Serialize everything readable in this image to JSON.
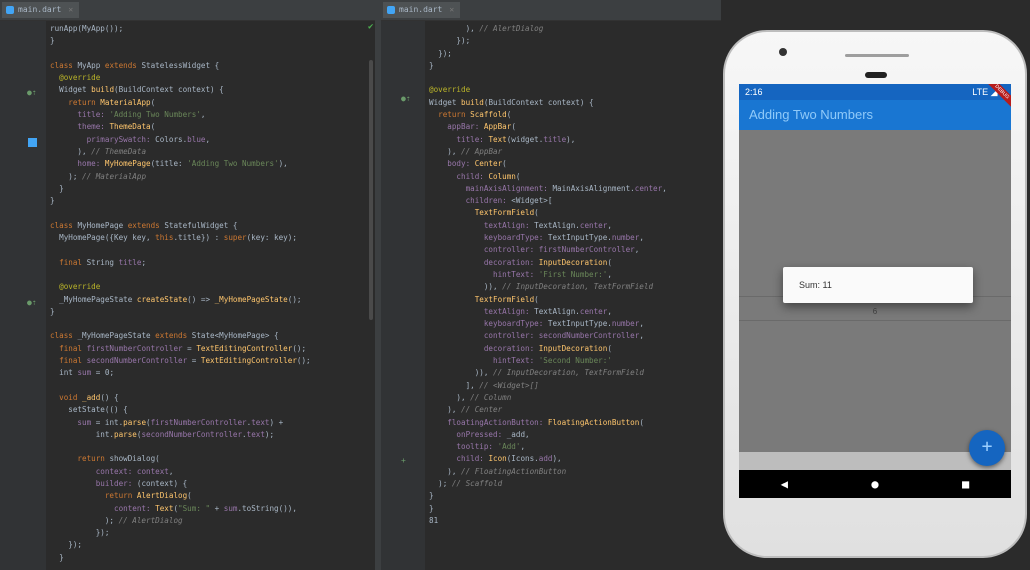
{
  "editor_left": {
    "tab_label": "main.dart",
    "line_numbers": [
      "",
      "",
      "",
      "",
      "",
      "",
      "",
      "",
      "",
      "",
      "",
      "",
      "",
      "",
      "",
      "",
      "",
      "",
      "",
      "",
      "",
      "",
      "",
      "",
      "",
      "",
      "",
      "",
      "",
      "",
      "",
      "",
      "",
      "",
      "",
      "",
      "",
      "",
      "",
      "",
      "",
      "",
      "",
      "",
      ""
    ],
    "lines": [
      [
        [
          "t",
          "runApp(MyApp());"
        ]
      ],
      [
        [
          "t",
          "}"
        ]
      ],
      [],
      [
        [
          "kw",
          "class "
        ],
        [
          "t",
          "MyApp "
        ],
        [
          "kw",
          "extends "
        ],
        [
          "t",
          "StatelessWidget {"
        ]
      ],
      [
        [
          "ann",
          "  @override"
        ]
      ],
      [
        [
          "t",
          "  Widget "
        ],
        [
          "fn",
          "build"
        ],
        [
          "t",
          "(BuildContext context) {"
        ]
      ],
      [
        [
          "kw",
          "    return "
        ],
        [
          "fn",
          "MaterialApp"
        ],
        [
          "t",
          "("
        ]
      ],
      [
        [
          "prop",
          "      title: "
        ],
        [
          "str",
          "'Adding Two Numbers'"
        ],
        [
          "t",
          ","
        ]
      ],
      [
        [
          "prop",
          "      theme: "
        ],
        [
          "fn",
          "ThemeData"
        ],
        [
          "t",
          "("
        ]
      ],
      [
        [
          "prop",
          "        primarySwatch: "
        ],
        [
          "t",
          "Colors."
        ],
        [
          "prop",
          "blue"
        ],
        [
          "t",
          ","
        ]
      ],
      [
        [
          "t",
          "      ), "
        ],
        [
          "cmt",
          "// ThemeData"
        ]
      ],
      [
        [
          "prop",
          "      home: "
        ],
        [
          "fn",
          "MyHomePage"
        ],
        [
          "t",
          "(title: "
        ],
        [
          "str",
          "'Adding Two Numbers'"
        ],
        [
          "t",
          "),"
        ]
      ],
      [
        [
          "t",
          "    ); "
        ],
        [
          "cmt",
          "// MaterialApp"
        ]
      ],
      [
        [
          "t",
          "  }"
        ]
      ],
      [
        [
          "t",
          "}"
        ]
      ],
      [],
      [
        [
          "kw",
          "class "
        ],
        [
          "t",
          "MyHomePage "
        ],
        [
          "kw",
          "extends "
        ],
        [
          "t",
          "StatefulWidget {"
        ]
      ],
      [
        [
          "t",
          "  MyHomePage({Key key, "
        ],
        [
          "kw",
          "this"
        ],
        [
          "t",
          ".title}) : "
        ],
        [
          "kw",
          "super"
        ],
        [
          "t",
          "(key: key);"
        ]
      ],
      [],
      [
        [
          "kw",
          "  final "
        ],
        [
          "t",
          "String "
        ],
        [
          "prop",
          "title"
        ],
        [
          "t",
          ";"
        ]
      ],
      [],
      [
        [
          "ann",
          "  @override"
        ]
      ],
      [
        [
          "t",
          "  _MyHomePageState "
        ],
        [
          "fn",
          "createState"
        ],
        [
          "t",
          "() => "
        ],
        [
          "fn",
          "_MyHomePageState"
        ],
        [
          "t",
          "();"
        ]
      ],
      [
        [
          "t",
          "}"
        ]
      ],
      [],
      [
        [
          "kw",
          "class "
        ],
        [
          "t",
          "_MyHomePageState "
        ],
        [
          "kw",
          "extends "
        ],
        [
          "t",
          "State<MyHomePage> {"
        ]
      ],
      [
        [
          "kw",
          "  final "
        ],
        [
          "prop",
          "firstNumberController"
        ],
        [
          "t",
          " = "
        ],
        [
          "fn",
          "TextEditingController"
        ],
        [
          "t",
          "();"
        ]
      ],
      [
        [
          "kw",
          "  final "
        ],
        [
          "prop",
          "secondNumberController"
        ],
        [
          "t",
          " = "
        ],
        [
          "fn",
          "TextEditingController"
        ],
        [
          "t",
          "();"
        ]
      ],
      [
        [
          "t",
          "  int "
        ],
        [
          "prop",
          "sum"
        ],
        [
          "t",
          " = "
        ],
        [
          "t",
          "0;"
        ]
      ],
      [],
      [
        [
          "kw",
          "  void "
        ],
        [
          "fn",
          "_add"
        ],
        [
          "t",
          "() {"
        ]
      ],
      [
        [
          "t",
          "    setState(() {"
        ]
      ],
      [
        [
          "prop",
          "      sum"
        ],
        [
          "t",
          " = int."
        ],
        [
          "fn",
          "parse"
        ],
        [
          "t",
          "("
        ],
        [
          "prop",
          "firstNumberController"
        ],
        [
          "t",
          "."
        ],
        [
          "prop",
          "text"
        ],
        [
          "t",
          ") +"
        ]
      ],
      [
        [
          "t",
          "          int."
        ],
        [
          "fn",
          "parse"
        ],
        [
          "t",
          "("
        ],
        [
          "prop",
          "secondNumberController"
        ],
        [
          "t",
          "."
        ],
        [
          "prop",
          "text"
        ],
        [
          "t",
          ");"
        ]
      ],
      [],
      [
        [
          "kw",
          "      return "
        ],
        [
          "t",
          "showDialog("
        ]
      ],
      [
        [
          "prop",
          "          context: "
        ],
        [
          "prop",
          "context"
        ],
        [
          "t",
          ","
        ]
      ],
      [
        [
          "prop",
          "          builder: "
        ],
        [
          "t",
          "(context) {"
        ]
      ],
      [
        [
          "kw",
          "            return "
        ],
        [
          "fn",
          "AlertDialog"
        ],
        [
          "t",
          "("
        ]
      ],
      [
        [
          "prop",
          "              content: "
        ],
        [
          "fn",
          "Text"
        ],
        [
          "t",
          "("
        ],
        [
          "str",
          "\"Sum: \""
        ],
        [
          "t",
          " + "
        ],
        [
          "prop",
          "sum"
        ],
        [
          "t",
          ".toString()),"
        ]
      ],
      [
        [
          "t",
          "            ); "
        ],
        [
          "cmt",
          "// AlertDialog"
        ]
      ],
      [
        [
          "t",
          "          });"
        ]
      ],
      [
        [
          "t",
          "    });"
        ]
      ],
      [
        [
          "t",
          "  }"
        ]
      ]
    ]
  },
  "editor_right": {
    "tab_label": "main.dart",
    "lines": [
      [
        [
          "t",
          "        ), "
        ],
        [
          "cmt",
          "// AlertDialog"
        ]
      ],
      [
        [
          "t",
          "      });"
        ]
      ],
      [
        [
          "t",
          "  });"
        ]
      ],
      [
        [
          "t",
          "}"
        ]
      ],
      [],
      [
        [
          "ann",
          "@override"
        ]
      ],
      [
        [
          "t",
          "Widget "
        ],
        [
          "fn",
          "build"
        ],
        [
          "t",
          "(BuildContext context) {"
        ]
      ],
      [
        [
          "kw",
          "  return "
        ],
        [
          "fn",
          "Scaffold"
        ],
        [
          "t",
          "("
        ]
      ],
      [
        [
          "prop",
          "    appBar: "
        ],
        [
          "fn",
          "AppBar"
        ],
        [
          "t",
          "("
        ]
      ],
      [
        [
          "prop",
          "      title: "
        ],
        [
          "fn",
          "Text"
        ],
        [
          "t",
          "(widget."
        ],
        [
          "prop",
          "title"
        ],
        [
          "t",
          "),"
        ]
      ],
      [
        [
          "t",
          "    ), "
        ],
        [
          "cmt",
          "// AppBar"
        ]
      ],
      [
        [
          "prop",
          "    body: "
        ],
        [
          "fn",
          "Center"
        ],
        [
          "t",
          "("
        ]
      ],
      [
        [
          "prop",
          "      child: "
        ],
        [
          "fn",
          "Column"
        ],
        [
          "t",
          "("
        ]
      ],
      [
        [
          "prop",
          "        mainAxisAlignment: "
        ],
        [
          "t",
          "MainAxisAlignment."
        ],
        [
          "prop",
          "center"
        ],
        [
          "t",
          ","
        ]
      ],
      [
        [
          "prop",
          "        children: "
        ],
        [
          "t",
          "<Widget>["
        ]
      ],
      [
        [
          "fn",
          "          TextFormField"
        ],
        [
          "t",
          "("
        ]
      ],
      [
        [
          "prop",
          "            textAlign: "
        ],
        [
          "t",
          "TextAlign."
        ],
        [
          "prop",
          "center"
        ],
        [
          "t",
          ","
        ]
      ],
      [
        [
          "prop",
          "            keyboardType: "
        ],
        [
          "t",
          "TextInputType."
        ],
        [
          "prop",
          "number"
        ],
        [
          "t",
          ","
        ]
      ],
      [
        [
          "prop",
          "            controller: "
        ],
        [
          "prop",
          "firstNumberController"
        ],
        [
          "t",
          ","
        ]
      ],
      [
        [
          "prop",
          "            decoration: "
        ],
        [
          "fn",
          "InputDecoration"
        ],
        [
          "t",
          "("
        ]
      ],
      [
        [
          "prop",
          "              hintText: "
        ],
        [
          "str",
          "'First Number:'"
        ],
        [
          "t",
          ","
        ]
      ],
      [
        [
          "t",
          "            )), "
        ],
        [
          "cmt",
          "// InputDecoration, TextFormField"
        ]
      ],
      [
        [
          "fn",
          "          TextFormField"
        ],
        [
          "t",
          "("
        ]
      ],
      [
        [
          "prop",
          "            textAlign: "
        ],
        [
          "t",
          "TextAlign."
        ],
        [
          "prop",
          "center"
        ],
        [
          "t",
          ","
        ]
      ],
      [
        [
          "prop",
          "            keyboardType: "
        ],
        [
          "t",
          "TextInputType."
        ],
        [
          "prop",
          "number"
        ],
        [
          "t",
          ","
        ]
      ],
      [
        [
          "prop",
          "            controller: "
        ],
        [
          "prop",
          "secondNumberController"
        ],
        [
          "t",
          ","
        ]
      ],
      [
        [
          "prop",
          "            decoration: "
        ],
        [
          "fn",
          "InputDecoration"
        ],
        [
          "t",
          "("
        ]
      ],
      [
        [
          "prop",
          "              hintText: "
        ],
        [
          "str",
          "'Second Number:'"
        ]
      ],
      [
        [
          "t",
          "          )), "
        ],
        [
          "cmt",
          "// InputDecoration, TextFormField"
        ]
      ],
      [
        [
          "t",
          "        ], "
        ],
        [
          "cmt",
          "// <Widget>[]"
        ]
      ],
      [
        [
          "t",
          "      ), "
        ],
        [
          "cmt",
          "// Column"
        ]
      ],
      [
        [
          "t",
          "    ), "
        ],
        [
          "cmt",
          "// Center"
        ]
      ],
      [
        [
          "prop",
          "    floatingActionButton: "
        ],
        [
          "fn",
          "FloatingActionButton"
        ],
        [
          "t",
          "("
        ]
      ],
      [
        [
          "prop",
          "      onPressed: "
        ],
        [
          "t",
          "_add,"
        ]
      ],
      [
        [
          "prop",
          "      tooltip: "
        ],
        [
          "str",
          "'Add'"
        ],
        [
          "t",
          ","
        ]
      ],
      [
        [
          "prop",
          "      child: "
        ],
        [
          "fn",
          "Icon"
        ],
        [
          "t",
          "(Icons."
        ],
        [
          "prop",
          "add"
        ],
        [
          "t",
          "),"
        ]
      ],
      [
        [
          "t",
          "    ), "
        ],
        [
          "cmt",
          "// FloatingActionButton"
        ]
      ],
      [
        [
          "t",
          "  ); "
        ],
        [
          "cmt",
          "// Scaffold"
        ]
      ],
      [
        [
          "t",
          "}"
        ]
      ],
      [
        [
          "t",
          "}"
        ]
      ],
      [
        [
          "t",
          "81"
        ]
      ]
    ]
  },
  "phone": {
    "status_time": "2:16",
    "status_icons": "LTE ◢ ▮",
    "debug_label": "DEBUG",
    "app_title": "Adding Two Numbers",
    "field_value": "6",
    "dialog_text": "Sum: 11",
    "fab_label": "+",
    "nav_back": "◀",
    "nav_home": "●",
    "nav_recents": "■"
  },
  "colors": {
    "editor_bg": "#2b2b2b",
    "gutter_bg": "#313335",
    "keyword": "#cc7832",
    "function": "#ffc66d",
    "string": "#6a8759",
    "comment": "#808080",
    "property": "#9876aa",
    "annotation": "#bbb529",
    "appbar": "#1976d2",
    "fab": "#1565c0"
  }
}
